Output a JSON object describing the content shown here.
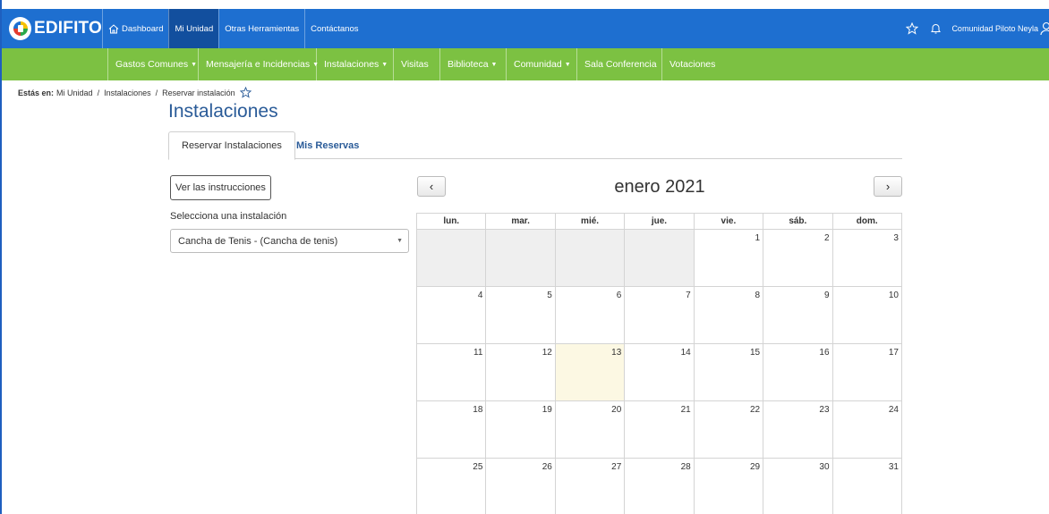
{
  "app": {
    "logo_text": "EDIFITO"
  },
  "topnav": [
    {
      "label": "Dashboard"
    },
    {
      "label": "Mi Unidad"
    },
    {
      "label": "Otras Herramientas"
    },
    {
      "label": "Contáctanos"
    }
  ],
  "user": {
    "name": "Comunidad Piloto Neyla"
  },
  "greennav": [
    {
      "label": "Gastos Comunes",
      "dropdown": true
    },
    {
      "label": "Mensajería e Incidencias",
      "dropdown": true
    },
    {
      "label": "Instalaciones",
      "dropdown": true
    },
    {
      "label": "Visitas",
      "dropdown": false
    },
    {
      "label": "Biblioteca",
      "dropdown": true
    },
    {
      "label": "Comunidad",
      "dropdown": true
    },
    {
      "label": "Sala Conferencia",
      "dropdown": false
    },
    {
      "label": "Votaciones",
      "dropdown": false
    }
  ],
  "breadcrumb": {
    "prefix": "Estás en:",
    "items": [
      "Mi Unidad",
      "Instalaciones",
      "Reservar instalación"
    ],
    "separator": "/"
  },
  "page": {
    "title": "Instalaciones"
  },
  "tabs": [
    {
      "label": "Reservar Instalaciones"
    },
    {
      "label": "Mis Reservas"
    }
  ],
  "instructions_button": "Ver las instrucciones",
  "select": {
    "label": "Selecciona una instalación",
    "value": "Cancha de Tenis - (Cancha de tenis)"
  },
  "calendar": {
    "title": "enero 2021",
    "prev": "‹",
    "next": "›",
    "weekdays": [
      "lun.",
      "mar.",
      "mié.",
      "jue.",
      "vie.",
      "sáb.",
      "dom."
    ],
    "weeks": [
      [
        "",
        "",
        "",
        "",
        "1",
        "2",
        "3"
      ],
      [
        "4",
        "5",
        "6",
        "7",
        "8",
        "9",
        "10"
      ],
      [
        "11",
        "12",
        "13",
        "14",
        "15",
        "16",
        "17"
      ],
      [
        "18",
        "19",
        "20",
        "21",
        "22",
        "23",
        "24"
      ],
      [
        "25",
        "26",
        "27",
        "28",
        "29",
        "30",
        "31"
      ]
    ],
    "today": "13"
  },
  "colors": {
    "topbar": "#1e6fd0",
    "greennav": "#7cc142",
    "title": "#2a5b98",
    "today_bg": "#fcf8e3"
  }
}
